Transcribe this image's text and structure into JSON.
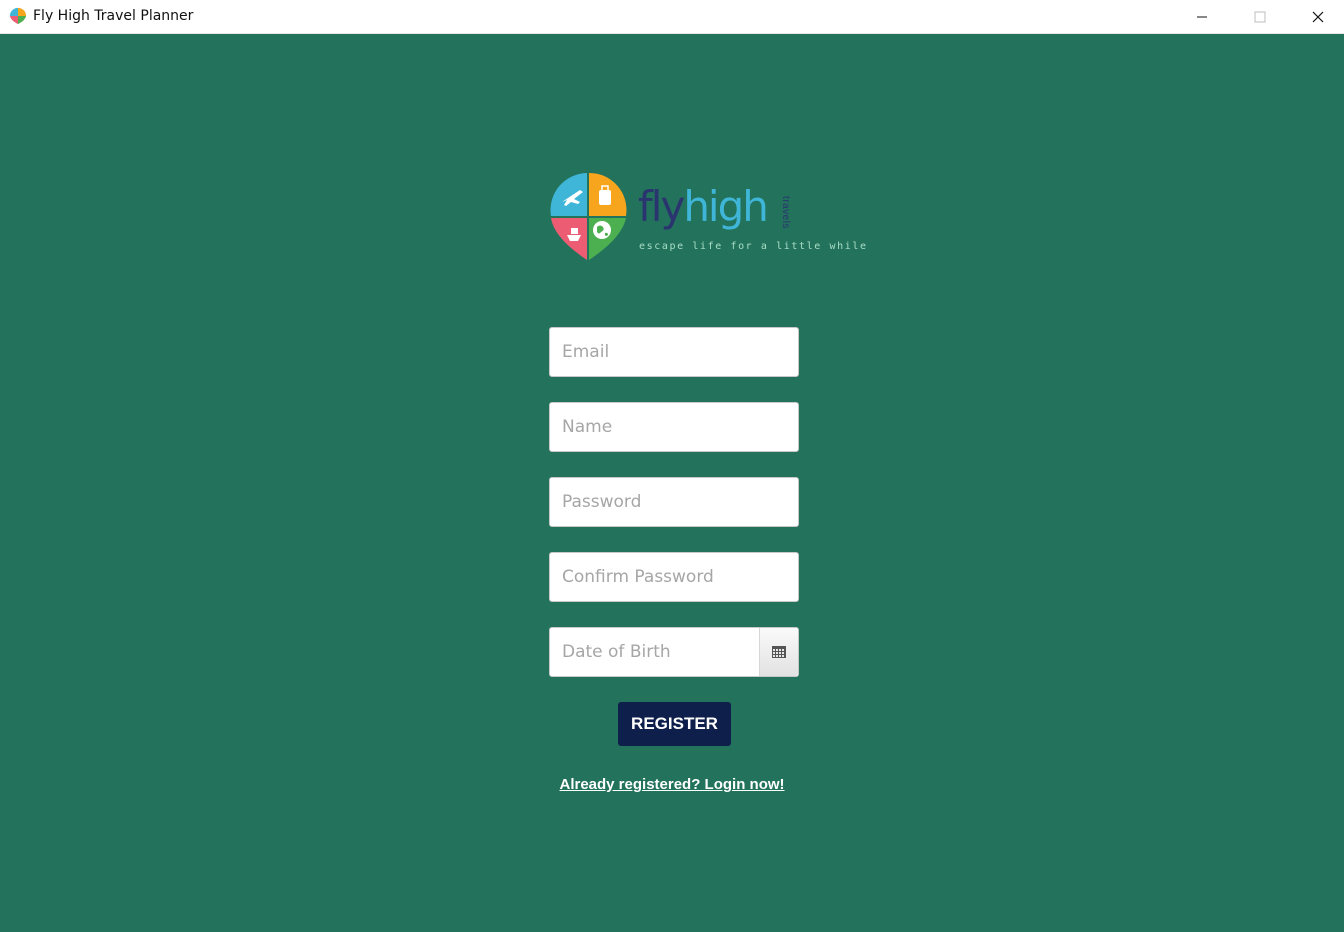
{
  "window": {
    "title": "Fly High Travel Planner",
    "app_icon": "fly-high-logo-icon",
    "controls": [
      "minimize-icon",
      "maximize-icon",
      "close-icon"
    ]
  },
  "colors": {
    "background": "#23725c",
    "button": "#0e1f4b",
    "brand_dark": "#2a3570",
    "brand_light": "#3fb6d8"
  },
  "brand": {
    "name_part1": "fly",
    "name_part2": "high",
    "vertical": "travels",
    "tagline": "escape life for a little while"
  },
  "form": {
    "email_placeholder": "Email",
    "name_placeholder": "Name",
    "password_placeholder": "Password",
    "confirm_placeholder": "Confirm Password",
    "dob_placeholder": "Date of Birth",
    "calendar_icon": "calendar-icon",
    "register_label": "REGISTER",
    "login_link": "Already registered? Login now!"
  }
}
